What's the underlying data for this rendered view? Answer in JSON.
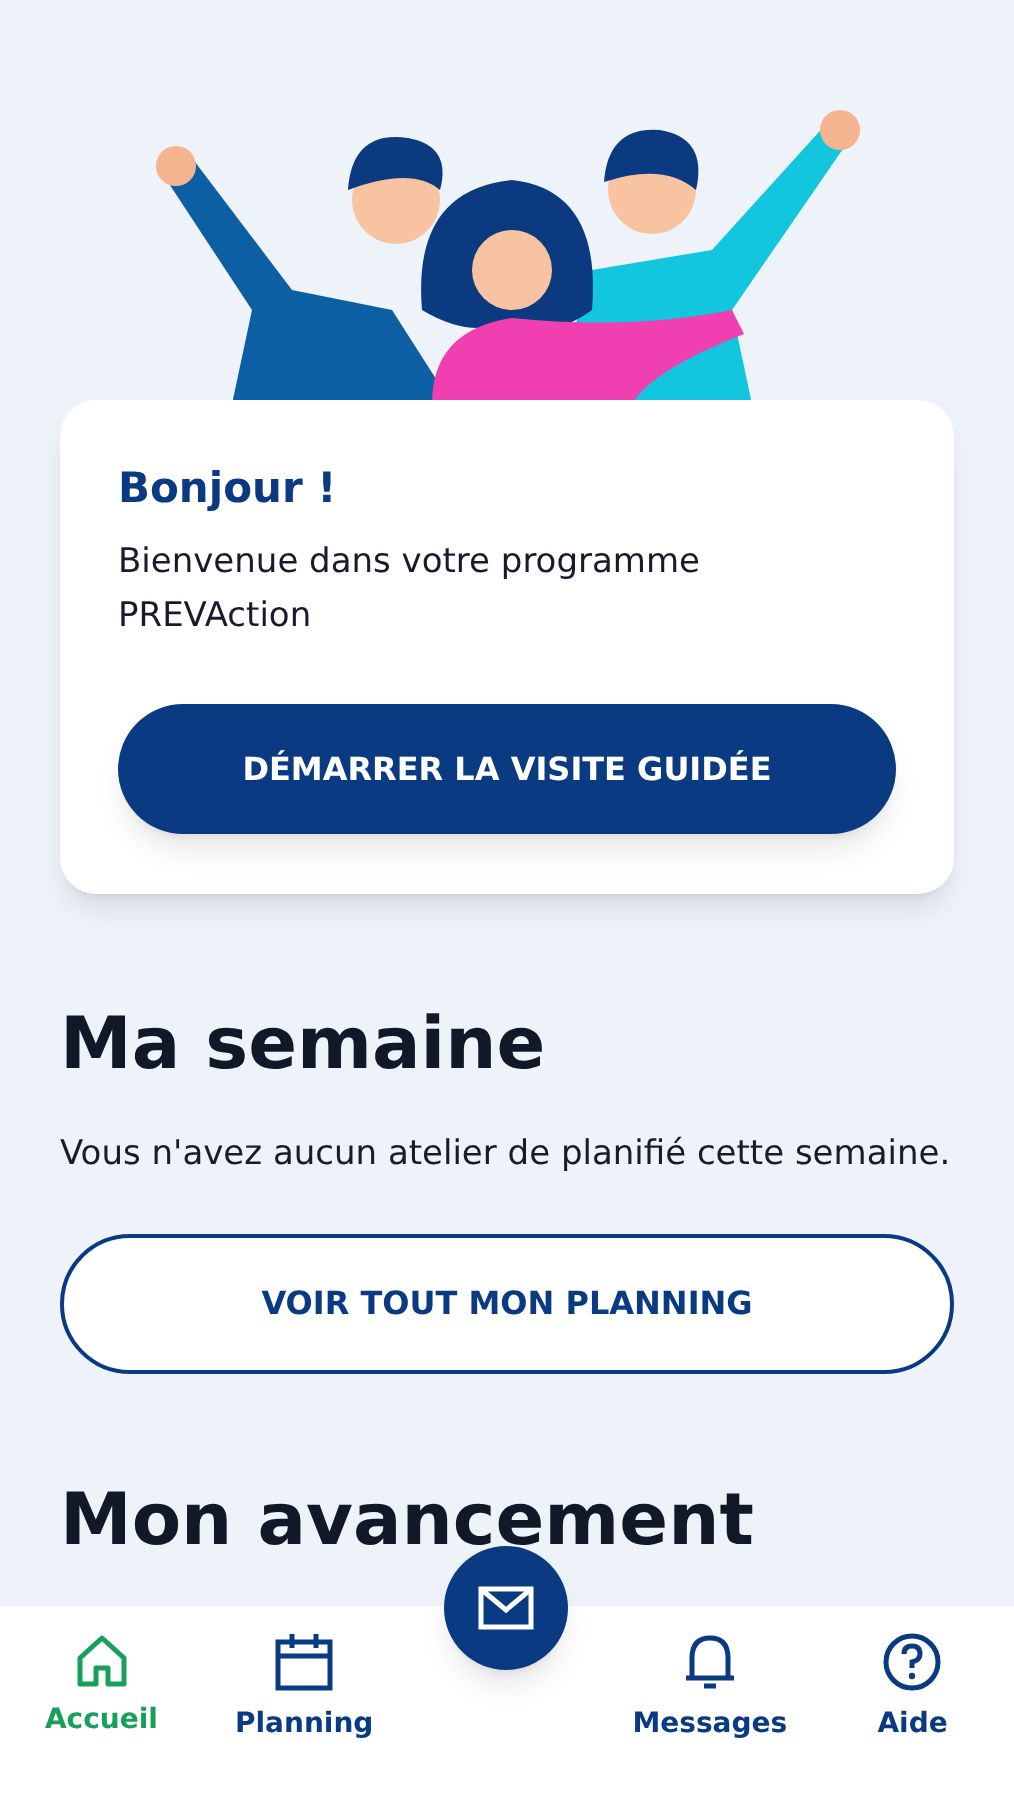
{
  "welcome_card": {
    "title": "Bonjour !",
    "message": "Bienvenue dans votre programme PREVAction",
    "button": "DÉMARRER LA VISITE GUIDÉE"
  },
  "week": {
    "title": "Ma semaine",
    "message": "Vous n'avez aucun atelier de planifié cette semaine.",
    "button": "VOIR TOUT MON PLANNING"
  },
  "progress": {
    "title": "Mon avancement"
  },
  "bottom_nav": [
    {
      "kind": "home",
      "label": "Accueil",
      "selected": true
    },
    {
      "kind": "calendar",
      "label": "Planning",
      "selected": false
    },
    {
      "kind": "mail",
      "selected": false
    },
    {
      "kind": "bell",
      "label": "Messages",
      "selected": false
    },
    {
      "kind": "help",
      "label": "Aide",
      "selected": false
    }
  ]
}
